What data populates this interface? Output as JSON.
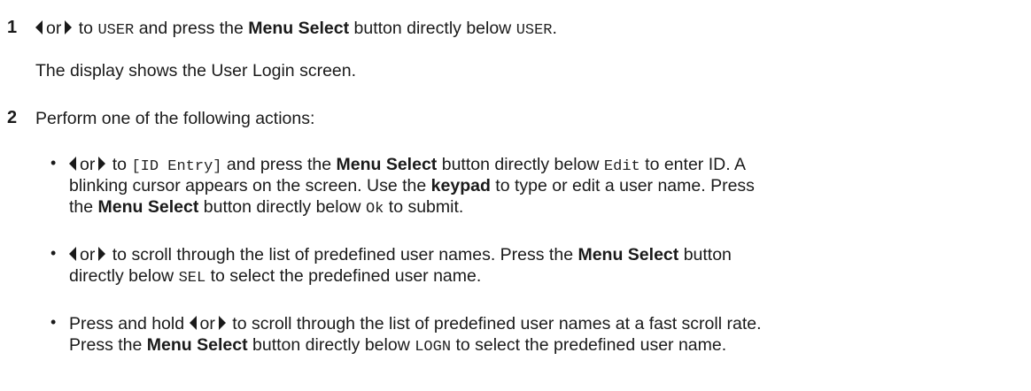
{
  "step1": {
    "number": "1",
    "or": "or",
    "to": "to",
    "menu_user": "USER",
    "press_text": "and press the",
    "menu_select": "Menu Select",
    "below_text": "button directly below",
    "period": ".",
    "result": "The display shows the User Login screen."
  },
  "step2": {
    "number": "2",
    "intro": "Perform one of the following actions:",
    "bullet1": {
      "or": "or",
      "to": "to",
      "id_entry": "[ID Entry]",
      "press_text": "and press the",
      "menu_select": "Menu Select",
      "below_text": "button directly below",
      "edit": "Edit",
      "after_edit": "to enter ID. A",
      "line2_a": "blinking cursor appears on the screen. Use the",
      "keypad": "keypad",
      "line2_b": "to type or edit a user name. Press",
      "line3_a": "the",
      "menu_select2": "Menu Select",
      "line3_b": "button directly below",
      "ok": "Ok",
      "line3_c": "to submit."
    },
    "bullet2": {
      "or": "or",
      "line1_a": "to scroll through the list of predefined user names. Press the",
      "menu_select": "Menu Select",
      "line1_b": "button",
      "line2_a": "directly below",
      "sel": "SEL",
      "line2_b": "to select the predefined user name."
    },
    "bullet3": {
      "line1_a": "Press and hold",
      "or": "or",
      "line1_b": "to scroll through the list of predefined user names at a fast scroll rate.",
      "line2_a": "Press the",
      "menu_select": "Menu Select",
      "line2_b": "button directly below",
      "logn": "LOGN",
      "line2_c": "to select the predefined user name."
    },
    "bullet_char": "•"
  },
  "icons": {
    "left": "left-arrow-icon",
    "right": "right-arrow-icon"
  }
}
